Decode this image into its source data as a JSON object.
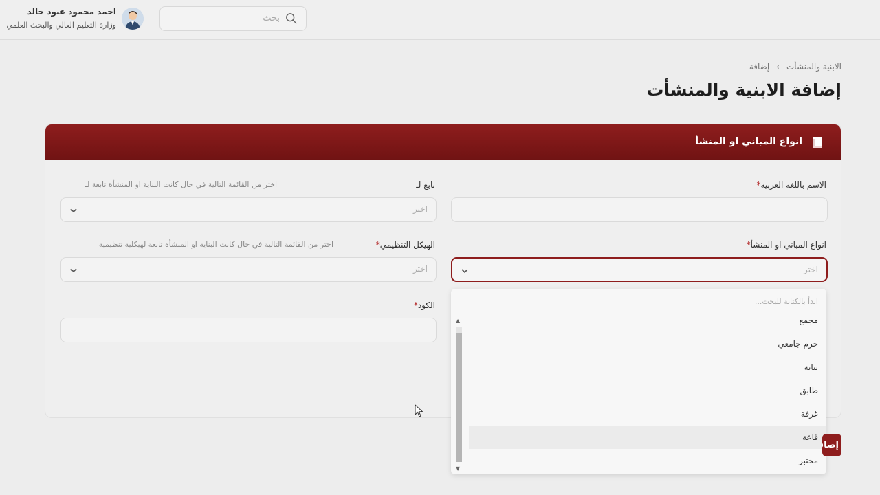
{
  "header": {
    "search_placeholder": "بحث",
    "user_name": "احمد محمود عبود خالد",
    "user_org": "وزارة التعليم العالي والبحث العلمي"
  },
  "breadcrumb": {
    "parent": "الابنية والمنشأت",
    "current": "إضافة"
  },
  "page_title": "إضافة الابنية والمنشأت",
  "card": {
    "title": "انواع المباني او المنشأ",
    "fields": {
      "arabic_name": {
        "label": "الاسم باللغة العربية",
        "value": ""
      },
      "parent": {
        "label": "تابع لـ",
        "hint": "اختر من القائمة التالية في حال كانت البناية او المنشأة تابعة لـ",
        "placeholder": "اختر"
      },
      "building_type": {
        "label": "انواع المباني او المنشأ",
        "placeholder": "اختر"
      },
      "org_structure": {
        "label": "الهيكل التنظيمي",
        "hint": "اختر من القائمة التالية في حال كانت البناية او المنشأة تابعة لهيكلية تنظيمية",
        "placeholder": "اختر"
      },
      "code": {
        "label": "الكود",
        "value": ""
      }
    }
  },
  "dropdown": {
    "search_placeholder": "ابدأ بالكتابة للبحث...",
    "options": [
      "مجمع",
      "حرم جامعي",
      "بناية",
      "طابق",
      "غرفة",
      "قاعة",
      "مختبر"
    ],
    "hovered": "قاعة"
  },
  "submit_label": "إضافة",
  "colors": {
    "brand": "#8e1d1d",
    "required": "#b12020"
  }
}
